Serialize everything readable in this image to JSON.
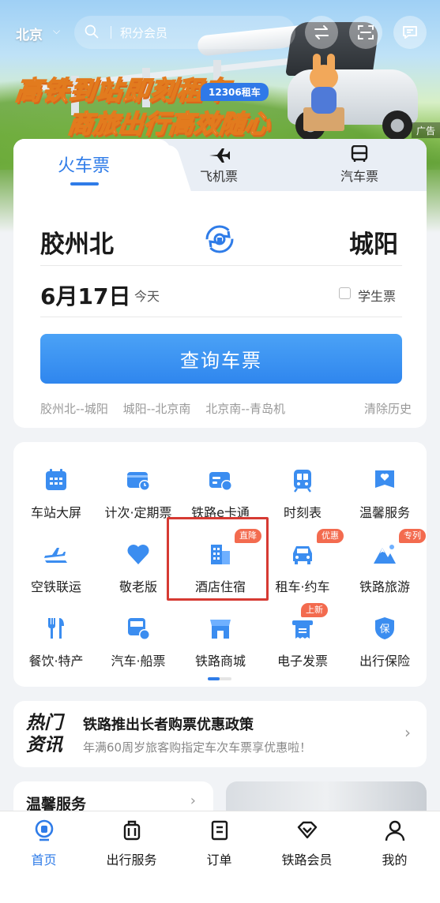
{
  "banner": {
    "headline1": "高铁到站即刻租车",
    "headline2": "商旅出行高效随心",
    "tag": "12306租车",
    "ad_label": "广告"
  },
  "topbar": {
    "city": "北京",
    "search_placeholder": "积分会员"
  },
  "ticket": {
    "tabs": [
      {
        "label": "火车票",
        "active": true
      },
      {
        "label": "飞机票",
        "icon": "plane-icon"
      },
      {
        "label": "汽车票",
        "icon": "bus-icon"
      }
    ],
    "from": "胶州北",
    "to": "城阳",
    "date": "6月17日",
    "day": "今天",
    "student_label": "学生票",
    "student_checked": false,
    "query_button": "查询车票",
    "history": [
      "胶州北--城阳",
      "城阳--北京南",
      "北京南--青岛机"
    ],
    "clear_history": "清除历史"
  },
  "services": [
    {
      "label": "车站大屏",
      "icon": "calendar-icon"
    },
    {
      "label": "计次·定期票",
      "icon": "card-clock-icon"
    },
    {
      "label": "铁路e卡通",
      "icon": "ecard-icon"
    },
    {
      "label": "时刻表",
      "icon": "train-front-icon"
    },
    {
      "label": "温馨服务",
      "icon": "heart-box-icon"
    },
    {
      "label": "空铁联运",
      "icon": "plane-train-icon"
    },
    {
      "label": "敬老版",
      "icon": "heart-icon"
    },
    {
      "label": "酒店住宿",
      "icon": "hotel-icon",
      "badge": "直降"
    },
    {
      "label": "租车·约车",
      "icon": "car-icon",
      "badge": "优惠"
    },
    {
      "label": "铁路旅游",
      "icon": "mountain-icon",
      "badge": "专列"
    },
    {
      "label": "餐饮·特产",
      "icon": "fork-knife-icon"
    },
    {
      "label": "汽车·船票",
      "icon": "bus-ticket-icon"
    },
    {
      "label": "铁路商城",
      "icon": "shop-icon"
    },
    {
      "label": "电子发票",
      "icon": "invoice-icon",
      "badge": "上新"
    },
    {
      "label": "出行保险",
      "icon": "shield-icon"
    }
  ],
  "news": {
    "tag": "热门资讯",
    "title": "铁路推出长者购票优惠政策",
    "subtitle": "年满60周岁旅客购指定车次车票享优惠啦！"
  },
  "bottom_card": {
    "title": "温馨服务"
  },
  "nav": [
    {
      "label": "首页",
      "active": true
    },
    {
      "label": "出行服务"
    },
    {
      "label": "订单"
    },
    {
      "label": "铁路会员"
    },
    {
      "label": "我的"
    }
  ],
  "colors": {
    "primary": "#2f7ce8",
    "badge": "#f36b4f",
    "highlight": "#d63a33"
  }
}
